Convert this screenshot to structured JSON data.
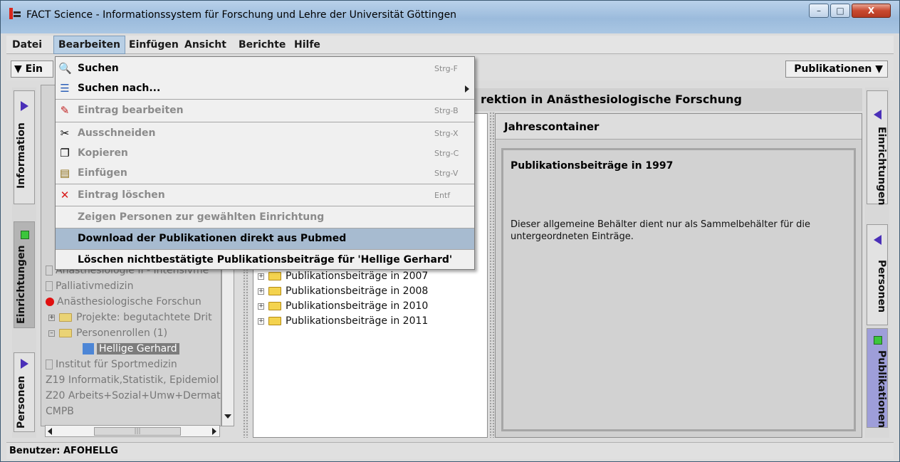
{
  "window": {
    "title": "FACT Science - Informationssystem für Forschung und Lehre der Universität Göttingen",
    "buttons": {
      "minimize": "–",
      "maximize": "□",
      "close": "X"
    }
  },
  "menubar": {
    "items": [
      "Datei",
      "Bearbeiten",
      "Einfügen",
      "Ansicht",
      "Berichte",
      "Hilfe"
    ],
    "active": "Bearbeiten"
  },
  "toolbar": {
    "left_combo": "Ein",
    "right_combo": "Publikationen"
  },
  "dropdown": {
    "items": [
      {
        "label": "Suchen",
        "shortcut": "Strg-F",
        "icon": "magnifier-icon",
        "enabled": true
      },
      {
        "label": "Suchen nach...",
        "shortcut": "",
        "icon": "search-list-icon",
        "enabled": true,
        "submenu": true
      },
      {
        "label": "Eintrag bearbeiten",
        "shortcut": "Strg-B",
        "icon": "edit-icon",
        "enabled": false
      },
      {
        "label": "Ausschneiden",
        "shortcut": "Strg-X",
        "icon": "scissors-icon",
        "enabled": false
      },
      {
        "label": "Kopieren",
        "shortcut": "Strg-C",
        "icon": "copy-icon",
        "enabled": false
      },
      {
        "label": "Einfügen",
        "shortcut": "Strg-V",
        "icon": "paste-icon",
        "enabled": false
      },
      {
        "label": "Eintrag löschen",
        "shortcut": "Entf",
        "icon": "delete-x-icon",
        "enabled": false
      },
      {
        "label": "Zeigen Personen zur gewählten Einrichtung",
        "shortcut": "",
        "enabled": false
      },
      {
        "label": "Download der Publikationen direkt aus Pubmed",
        "shortcut": "",
        "enabled": true,
        "highlighted": true
      },
      {
        "label": "Löschen nichtbestätigte Publikationsbeiträge für 'Hellige Gerhard'",
        "shortcut": "",
        "enabled": true
      }
    ]
  },
  "left_tabs": [
    "Information",
    "Einrichtungen",
    "Personen"
  ],
  "right_tabs": [
    "Einrichtungen",
    "Personen",
    "Publikationen"
  ],
  "tree": {
    "items": [
      {
        "text": "Anästhesiologie II - Intensivme"
      },
      {
        "text": "Palliativmedizin"
      },
      {
        "text": "Anästhesiologische Forschun"
      },
      {
        "text": "Projekte: begutachtete Drit"
      },
      {
        "text": "Personenrollen (1)"
      },
      {
        "text": "Hellige Gerhard",
        "selected": true
      },
      {
        "text": "Institut für Sportmedizin"
      },
      {
        "text": "Z19 Informatik,Statistik, Epidemiol"
      },
      {
        "text": "Z20 Arbeits+Sozial+Umw+Dermat"
      },
      {
        "text": "CMPB"
      }
    ]
  },
  "center": {
    "header": "rektion in Anästhesiologische Forschung",
    "list": [
      "Publikationsbeiträge in 2007",
      "Publikationsbeiträge in 2008",
      "Publikationsbeiträge in 2010",
      "Publikationsbeiträge in 2011"
    ]
  },
  "detail": {
    "header": "Jahrescontainer",
    "title": "Publikationsbeiträge in 1997",
    "text": "Dieser allgemeine Behälter dient nur als Sammelbehälter für die untergeordneten Einträge."
  },
  "status": "Benutzer: AFOHELLG"
}
